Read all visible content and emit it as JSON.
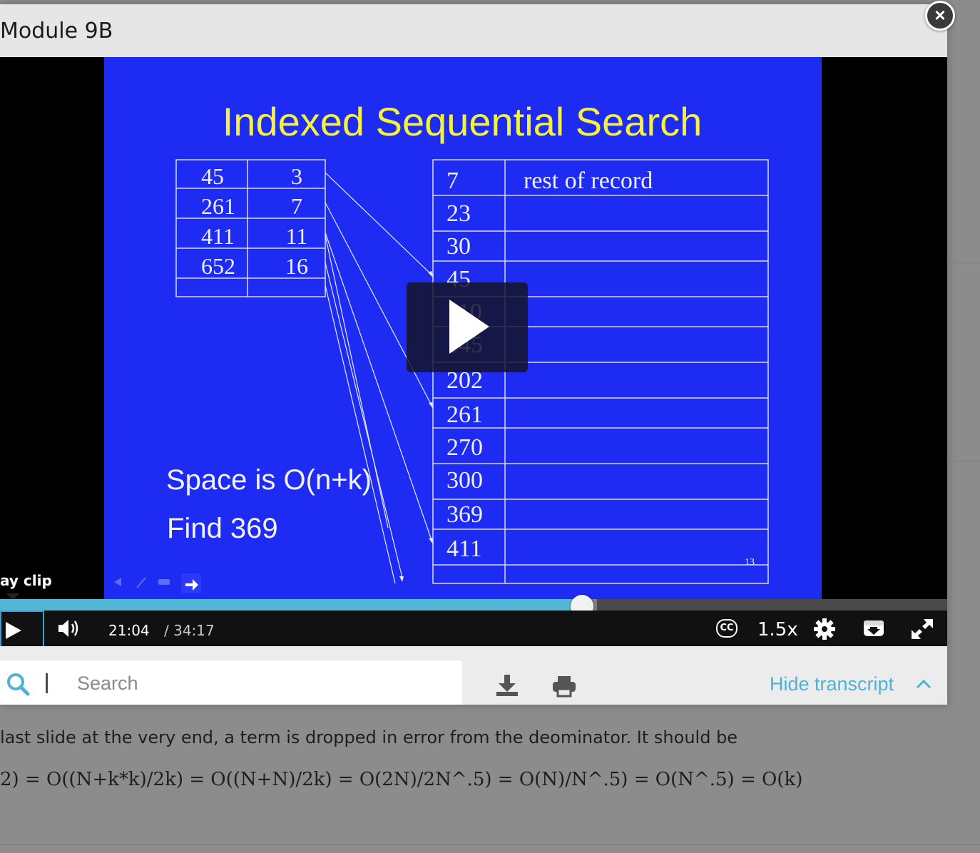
{
  "modal": {
    "title": "Module 9B",
    "close_label": "×"
  },
  "slide": {
    "title": "Indexed Sequential Search",
    "index_table": [
      [
        "45",
        "3"
      ],
      [
        "261",
        "7"
      ],
      [
        "411",
        "11"
      ],
      [
        "652",
        "16"
      ],
      [
        "",
        ""
      ]
    ],
    "record_col_header": "rest of record",
    "records": [
      "7",
      "23",
      "30",
      "45",
      "110",
      "145",
      "202",
      "261",
      "270",
      "300",
      "369",
      "411",
      ""
    ],
    "space_text": "Space is O(n+k)",
    "find_text": "Find 369",
    "slide_number": "13"
  },
  "player": {
    "clip_label": "ay clip",
    "time_current": "21:04",
    "time_total": "/ 34:17",
    "progress_fraction": 0.6142,
    "buffer_fraction": 0.63,
    "cc_label": "CC",
    "speed_label": "1.5x"
  },
  "transcript": {
    "search_placeholder": "Search",
    "hide_label": "Hide transcript"
  },
  "background": {
    "line1": "last slide at the very end, a term is dropped in error from the deominator.  It should be",
    "line2": "2) = O((N+k*k)/2k) = O((N+N)/2k) = O(2N)/2N^.5)  = O(N)/N^.5) = O(N^.5) =  O(k)"
  },
  "colors": {
    "slide_bg": "#1d2bf3",
    "slide_title": "#f5f23a",
    "progress": "#53b8d6",
    "link": "#4fb1d7"
  },
  "icons": [
    "close-icon",
    "play-icon",
    "volume-icon",
    "cc-icon",
    "gear-icon",
    "download-box-icon",
    "fullscreen-icon",
    "search-icon",
    "download-icon",
    "print-icon",
    "chevron-up-icon"
  ]
}
